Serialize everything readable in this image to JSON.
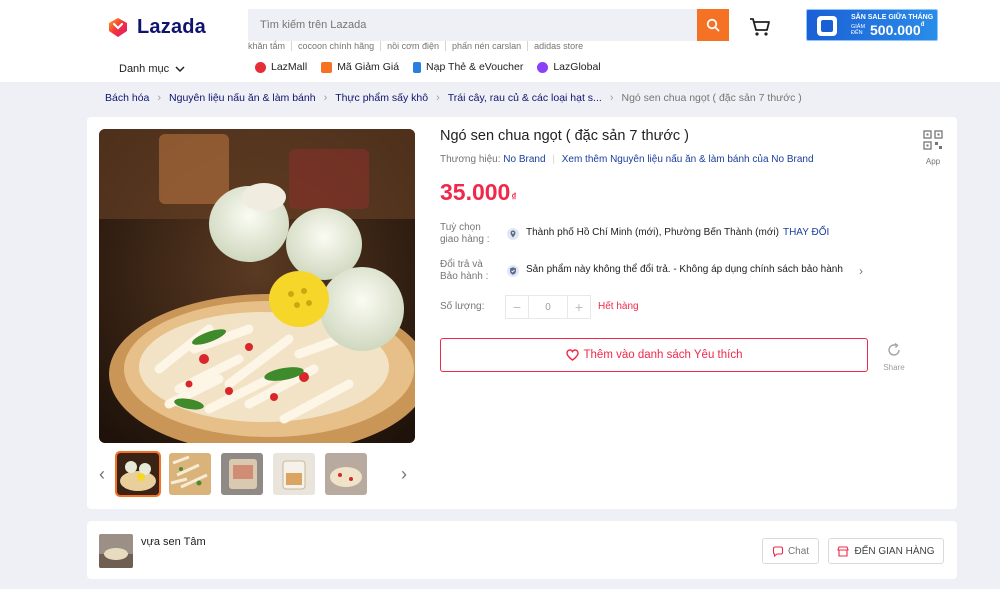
{
  "header": {
    "logo_text": "Lazada",
    "search_placeholder": "Tìm kiếm trên Lazada",
    "suggestions": [
      "khăn tắm",
      "cocoon chính hãng",
      "nồi cơm điện",
      "phấn nén carslan",
      "adidas store"
    ],
    "promo": {
      "line1": "SĂN SALE GIỮA THÁNG",
      "line2a": "GIẢM ĐẾN",
      "amount": "500.000",
      "currency": "đ"
    },
    "category_label": "Danh mục",
    "quick_links": [
      {
        "label": "LazMall",
        "icon": "lazmall-icon",
        "color": "#e62e39"
      },
      {
        "label": "Mã Giảm Giá",
        "icon": "voucher-icon",
        "color": "#f57224"
      },
      {
        "label": "Nạp Thẻ & eVoucher",
        "icon": "phone-topup-icon",
        "color": "#2a7de1"
      },
      {
        "label": "LazGlobal",
        "icon": "globe-icon",
        "color": "#8a3ffc"
      }
    ]
  },
  "breadcrumb": {
    "items": [
      "Bách hóa",
      "Nguyên liệu nấu ăn & làm bánh",
      "Thực phẩm sấy khô",
      "Trái cây, rau củ & các loại hạt s..."
    ],
    "current": "Ngó sen chua ngọt ( đặc sản 7 thước )"
  },
  "product": {
    "title": "Ngó sen chua ngọt ( đặc sản 7 thước )",
    "brand_label": "Thương hiệu:",
    "brand": "No Brand",
    "more_link": "Xem thêm Nguyên liệu nấu ăn & làm bánh của No Brand",
    "app_label": "App",
    "price": "35.000",
    "currency": "₫",
    "delivery_label_1": "Tuỳ chọn",
    "delivery_label_2": "giao hàng :",
    "delivery_location": "Thành phố Hồ Chí Minh (mới), Phường Bến Thành (mới)",
    "change_label": "THAY ĐỔI",
    "return_label_1": "Đổi trả và",
    "return_label_2": "Bảo hành :",
    "return_text": "Sản phẩm này không thể đổi trả. - Không áp dụng chính sách bảo hành",
    "qty_label": "Số lượng:",
    "qty_value": "0",
    "stock_status": "Hết hàng",
    "wishlist_label": "Thêm vào danh sách Yêu thích",
    "share_label": "Share",
    "thumbnail_count": 5
  },
  "seller": {
    "name": "vựa sen Tâm",
    "chat_label": "Chat",
    "shop_label": "ĐẾN GIAN HÀNG"
  },
  "colors": {
    "accent": "#f57224",
    "price": "#f0284a",
    "link": "#1a3e9e",
    "brand_navy": "#0f146d"
  }
}
